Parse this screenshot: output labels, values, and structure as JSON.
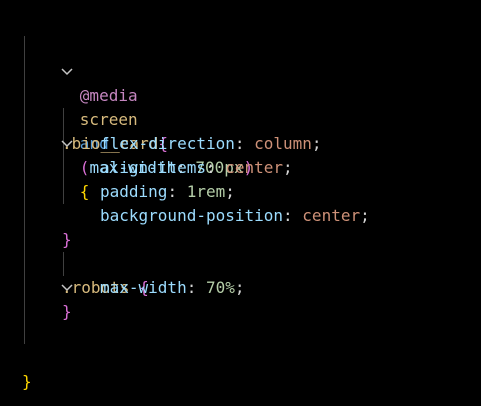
{
  "colors": {
    "background": "#000000",
    "at_rule": "#c586c0",
    "keyword": "#569cd6",
    "selector": "#d7ba7d",
    "property": "#9cdcfe",
    "value": "#ce9178",
    "number": "#b5cea8",
    "punctuation": "#d4d4d4",
    "brace_outer": "#ffd700",
    "brace_inner": "#da70d6",
    "paren": "#da70d6",
    "guide": "#404040",
    "chevron": "#c5c5c5"
  },
  "lines": {
    "l1": {
      "at": "@media",
      "screen": "screen",
      "and": "and",
      "lparen": "(",
      "prop": "max-width",
      "colon": ": ",
      "val": "700px",
      "rparen": ")",
      "brace": "{"
    },
    "l4": {
      "selector": ".bio__card",
      "brace": "{"
    },
    "l5": {
      "prop": "flex-direction",
      "colon": ": ",
      "val": "column",
      "semi": ";"
    },
    "l6": {
      "prop": "align-items",
      "colon": ": ",
      "val": "center",
      "semi": ";"
    },
    "l7": {
      "prop": "padding",
      "colon": ": ",
      "val": "1rem",
      "semi": ";"
    },
    "l8": {
      "prop": "background-position",
      "colon": ": ",
      "val": "center",
      "semi": ";"
    },
    "l9": {
      "brace": "}"
    },
    "l10": {
      "selector": ".robots",
      "brace": "{"
    },
    "l11": {
      "prop": "max-width",
      "colon": ": ",
      "val": "70%",
      "semi": ";"
    },
    "l12": {
      "brace": "}"
    },
    "l15": {
      "brace": "}"
    }
  }
}
